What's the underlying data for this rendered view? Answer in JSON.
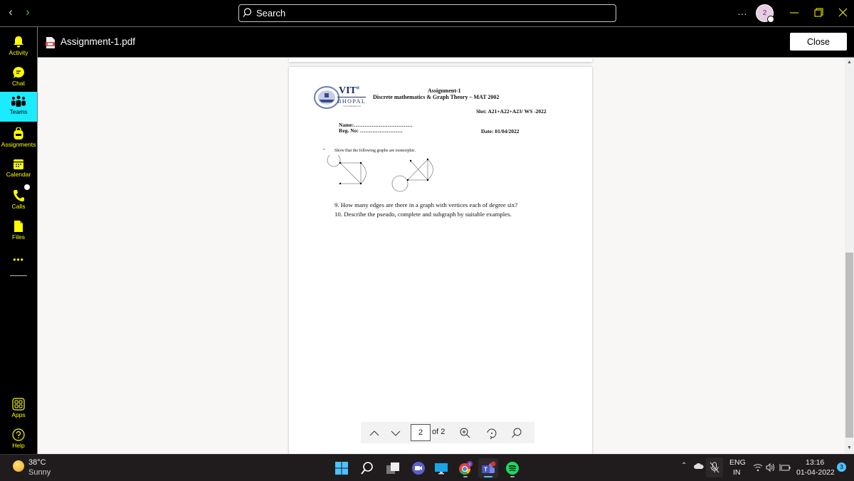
{
  "titlebar": {
    "back_icon": "chevron-left",
    "forward_icon": "chevron-right",
    "search_placeholder": "Search",
    "more_label": "…",
    "avatar_initial": "2",
    "window_controls": [
      "minimize",
      "maximize",
      "close"
    ]
  },
  "rail": {
    "items": [
      {
        "label": "Activity",
        "icon": "bell-icon",
        "active": false
      },
      {
        "label": "Chat",
        "icon": "chat-icon",
        "active": false
      },
      {
        "label": "Teams",
        "icon": "teams-icon",
        "active": true
      },
      {
        "label": "Assignments",
        "icon": "backpack-icon",
        "active": false
      },
      {
        "label": "Calendar",
        "icon": "calendar-icon",
        "active": false
      },
      {
        "label": "Calls",
        "icon": "phone-icon",
        "active": false
      },
      {
        "label": "Files",
        "icon": "file-icon",
        "active": false
      }
    ],
    "more_label": "•••",
    "bottom_items": [
      {
        "label": "Apps",
        "icon": "apps-icon"
      },
      {
        "label": "Help",
        "icon": "help-icon"
      }
    ]
  },
  "file_header": {
    "file_name": "Assignment-1.pdf",
    "close_label": "Close"
  },
  "document": {
    "logo_text": "VIT",
    "logo_sup": "®",
    "logo_sub": "BHOPAL",
    "logo_url": "www.vitbhopal.ac.in",
    "title": "Assignment-1",
    "course": "Discrete mathematics & Graph Theory – MAT 2002",
    "slot": "Slot: A21+A22+A23/ WS -2022",
    "name": "Name:……………………………",
    "reg_no": "Reg. No:  ……………………",
    "date": "Date: 01/04/2022",
    "bullet": "•",
    "q_isomorphic": "Show that the following graphs are isomorphic.",
    "q9": "9.  How many edges are there in a graph with vertices each of degree six?",
    "q10": "10. Describe the pseudo, complete and subgraph by suitable examples."
  },
  "pdf_toolbar": {
    "current_page": "2",
    "of_label": "of 2",
    "buttons": [
      "previous-page",
      "next-page",
      "zoom-in",
      "rotate",
      "search"
    ]
  },
  "taskbar": {
    "weather_temp": "38°C",
    "weather_condition": "Sunny",
    "apps": [
      "start",
      "search",
      "task-view",
      "meet",
      "desktop",
      "chrome",
      "teams",
      "spotify"
    ],
    "lang_primary": "ENG",
    "lang_secondary": "IN",
    "time": "13:16",
    "date": "01-04-2022",
    "notification_count": "3"
  }
}
